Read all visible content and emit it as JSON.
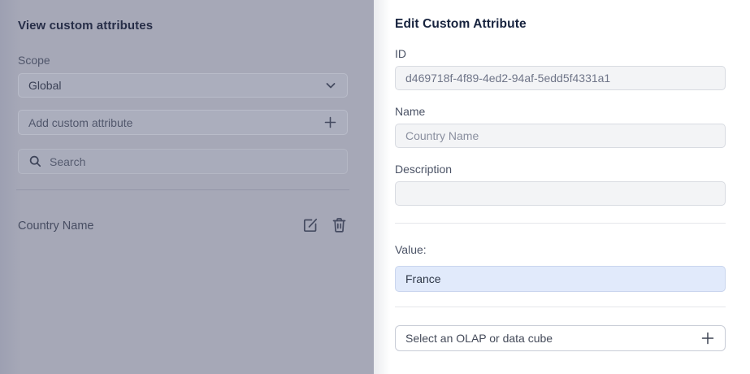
{
  "left_panel": {
    "title": "View custom attributes",
    "scope_label": "Scope",
    "scope_value": "Global",
    "add_placeholder": "Add custom attribute",
    "search_placeholder": "Search",
    "attributes": [
      {
        "name": "Country Name"
      }
    ]
  },
  "right_panel": {
    "title": "Edit Custom Attribute",
    "id_label": "ID",
    "id_value": "d469718f-4f89-4ed2-94af-5edd5f4331a1",
    "name_label": "Name",
    "name_placeholder": "Country Name",
    "description_label": "Description",
    "description_value": "",
    "value_label": "Value:",
    "value_value": "France",
    "olap_button_label": "Select an OLAP or data cube"
  },
  "icons": {
    "chevron": "chevron-down-icon",
    "plus": "plus-icon",
    "search": "search-icon",
    "edit": "edit-icon",
    "trash": "trash-icon"
  },
  "colors": {
    "backdrop": "#a6a8b7",
    "panel_bg": "#ffffff",
    "heading_text": "#17233e",
    "readonly_field_bg": "#f3f4f6",
    "value_field_bg": "#e1eafb",
    "value_field_border": "#c9d5ee",
    "divider": "#e5e7eb",
    "dim_control_bg": "#abaebd",
    "dim_control_border": "#b9bcc9"
  }
}
